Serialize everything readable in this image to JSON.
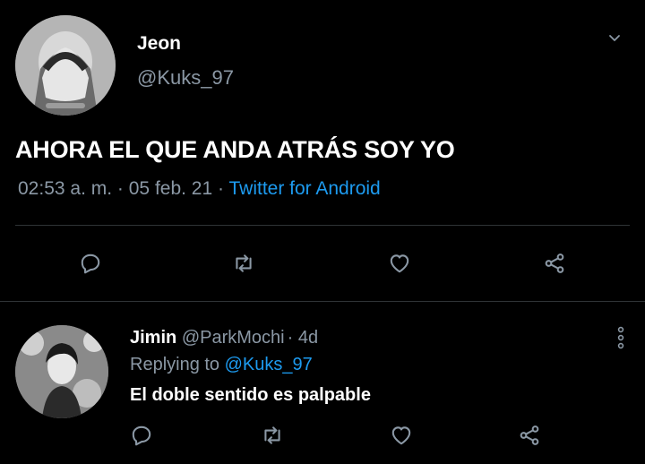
{
  "main_tweet": {
    "display_name": "Jeon",
    "handle": "@Kuks_97",
    "text": "AHORA EL QUE ANDA ATRÁS SOY YO",
    "time": "02:53 a. m.",
    "date": "05 feb. 21",
    "separator": "·",
    "source": "Twitter for Android"
  },
  "reply": {
    "display_name": "Jimin",
    "handle": "@ParkMochi",
    "age": "4d",
    "separator": "·",
    "replying_prefix": "Replying to",
    "replying_handle": "@Kuks_97",
    "text": "El doble sentido es palpable"
  },
  "icons": {
    "more": "chevron-down-icon",
    "reply": "reply-icon",
    "retweet": "retweet-icon",
    "like": "heart-icon",
    "share": "share-icon",
    "overflow": "vertical-ellipsis-icon"
  },
  "colors": {
    "background": "#000000",
    "text": "#ffffff",
    "muted": "#8b98a5",
    "link": "#1d9bf0",
    "divider": "#2f3336"
  }
}
